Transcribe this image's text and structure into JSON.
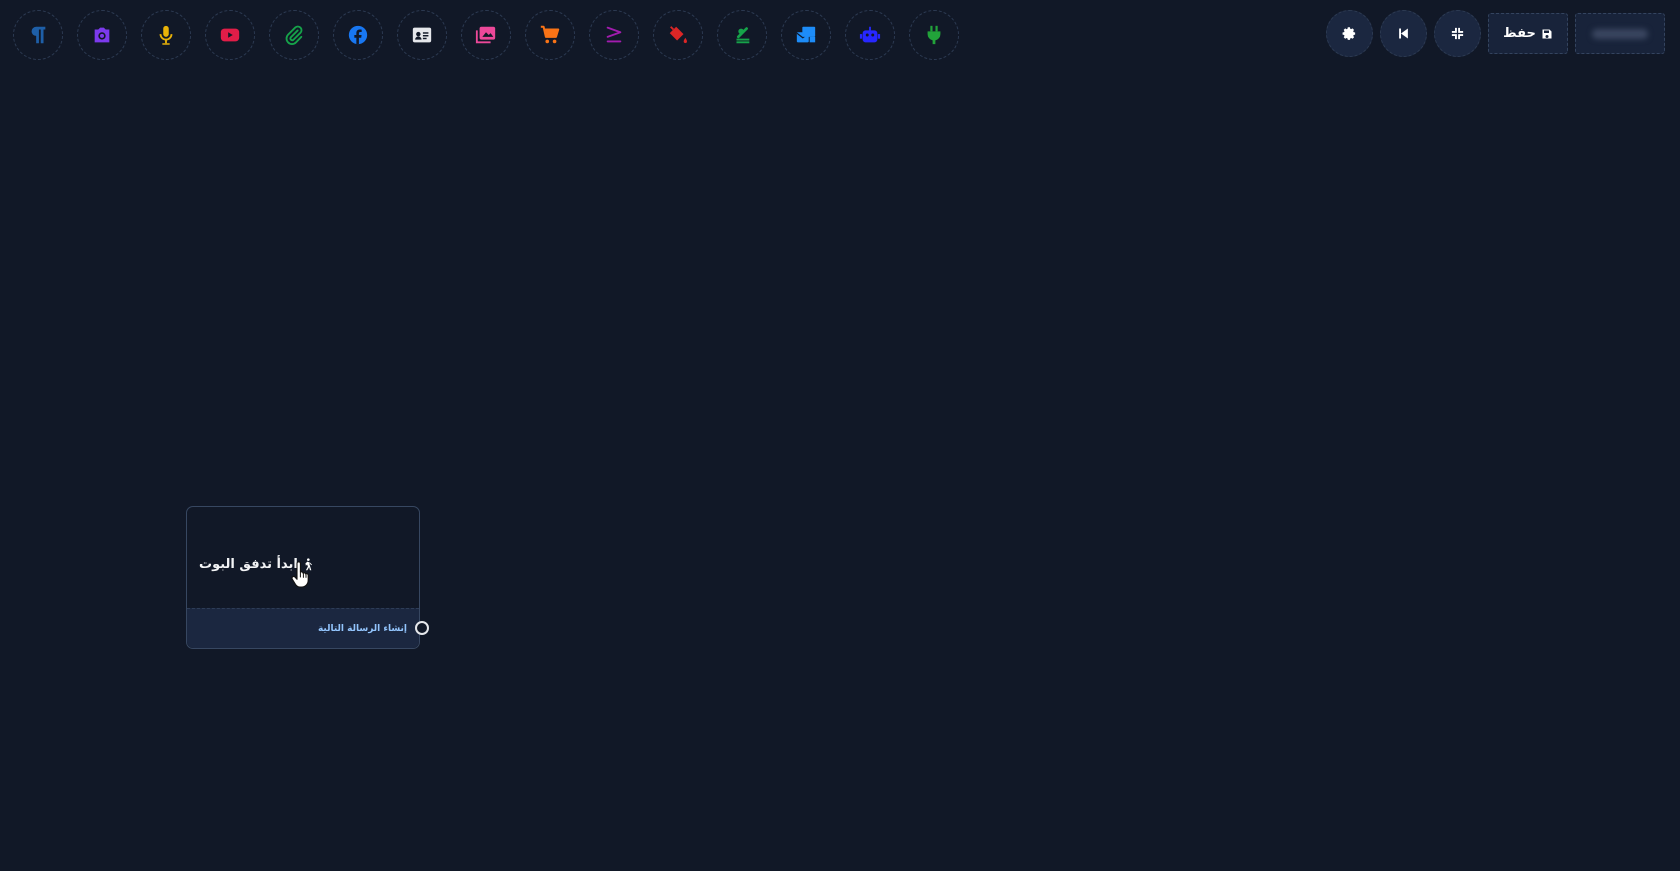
{
  "toolbar": {
    "items": [
      {
        "name": "paragraph-text-icon",
        "color": "#1e5fa8"
      },
      {
        "name": "camera-icon",
        "color": "#7c3aed"
      },
      {
        "name": "microphone-icon",
        "color": "#eab308"
      },
      {
        "name": "youtube-icon",
        "color": "#e11d48"
      },
      {
        "name": "paperclip-icon",
        "color": "#16a34a"
      },
      {
        "name": "facebook-icon",
        "color": "#1877f2"
      },
      {
        "name": "contact-card-icon",
        "color": "#e5e7eb"
      },
      {
        "name": "images-icon",
        "color": "#ec4899"
      },
      {
        "name": "shopping-cart-icon",
        "color": "#f97316"
      },
      {
        "name": "greater-equal-icon",
        "color": "#a21caf"
      },
      {
        "name": "paint-bucket-icon",
        "color": "#dc2626"
      },
      {
        "name": "money-stack-icon",
        "color": "#16a34a"
      },
      {
        "name": "mail-bulk-icon",
        "color": "#1d8cf8"
      },
      {
        "name": "robot-icon",
        "color": "#2727ff"
      },
      {
        "name": "plug-icon",
        "color": "#22a33a"
      }
    ]
  },
  "controls": {
    "settings_icon": "gear-icon",
    "back_icon": "skip-back-icon",
    "collapse_icon": "compress-icon",
    "save_label": "حفظ",
    "save_icon": "floppy-disk-icon"
  },
  "node": {
    "title": "ابدأ تدفق البوت",
    "title_icon": "walking-person-icon",
    "next_label": "إنشاء الرسالة التالية"
  },
  "colors": {
    "background": "#111827",
    "panel": "#1b2740",
    "border": "#374761",
    "accent_text": "#93c5fd"
  }
}
